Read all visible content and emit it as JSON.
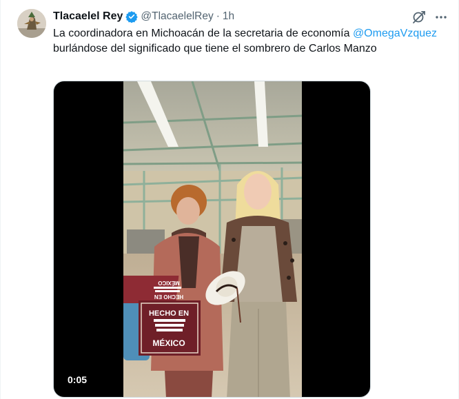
{
  "author": {
    "display_name": "Tlacaelel Rey",
    "handle": "@TlacaelelRey",
    "separator": "·",
    "time": "1h",
    "verified_color": "#1d9bf0"
  },
  "tweet": {
    "text_before": "La coordinadora en Michoacán de la secretaria de economía ",
    "mention": "@OmegaVzquez",
    "text_after": " burlándose del significado que tiene el sombrero de Carlos Manzo"
  },
  "media": {
    "timer": "0:05",
    "box_top": "HECHO EN",
    "box_top2": "MÉXICO",
    "box_front_line1": "HECHO EN",
    "box_front_line2": "MÉXICO"
  },
  "icons": {
    "verified": "verified-badge-icon",
    "grok": "grok-icon",
    "more": "more-icon"
  },
  "colors": {
    "link": "#1d9bf0",
    "secondary_text": "#536471",
    "primary_text": "#0f1419"
  }
}
